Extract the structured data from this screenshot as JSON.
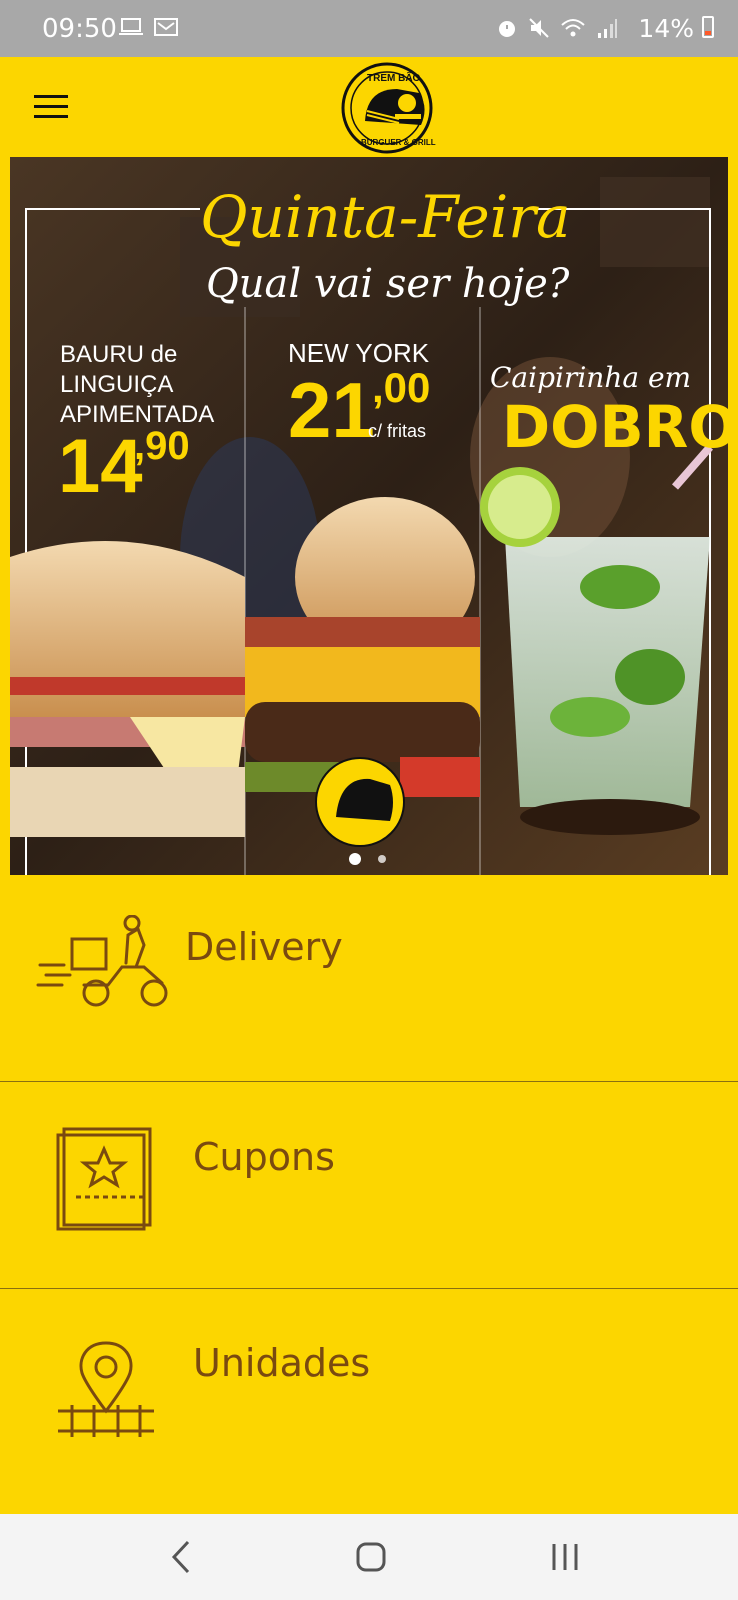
{
  "status_bar": {
    "time": "09:50",
    "battery": "14%",
    "left_icons": [
      "laptop-icon",
      "email-icon"
    ],
    "right_icons": [
      "alarm-icon",
      "mute-icon",
      "wifi-icon",
      "signal-icon"
    ]
  },
  "app_bar": {
    "logo_top_text": "TREM BÃO",
    "logo_bottom_text": "BURGUER & GRILL"
  },
  "banner": {
    "title": "Quinta-Feira",
    "subtitle": "Qual vai ser hoje?",
    "offer1": {
      "line1": "BAURU de",
      "line2": "LINGUIÇA",
      "line3": "APIMENTADA",
      "price_int": "14",
      "price_dec": ",90"
    },
    "offer2": {
      "name": "NEW YORK",
      "price_int": "21",
      "price_dec": ",00",
      "note": "c/ fritas"
    },
    "offer3": {
      "line1": "Caipirinha em",
      "line2": "DOBRO"
    },
    "carousel": {
      "total": 2,
      "active": 1
    }
  },
  "menu": {
    "items": [
      {
        "label": "Delivery",
        "icon": "delivery-scooter-icon"
      },
      {
        "label": "Cupons",
        "icon": "coupon-star-icon"
      },
      {
        "label": "Unidades",
        "icon": "location-pin-track-icon"
      }
    ]
  },
  "colors": {
    "brand_yellow": "#FCD600",
    "label_brown": "#7A4A10",
    "status_gray": "#A8A8A8"
  }
}
